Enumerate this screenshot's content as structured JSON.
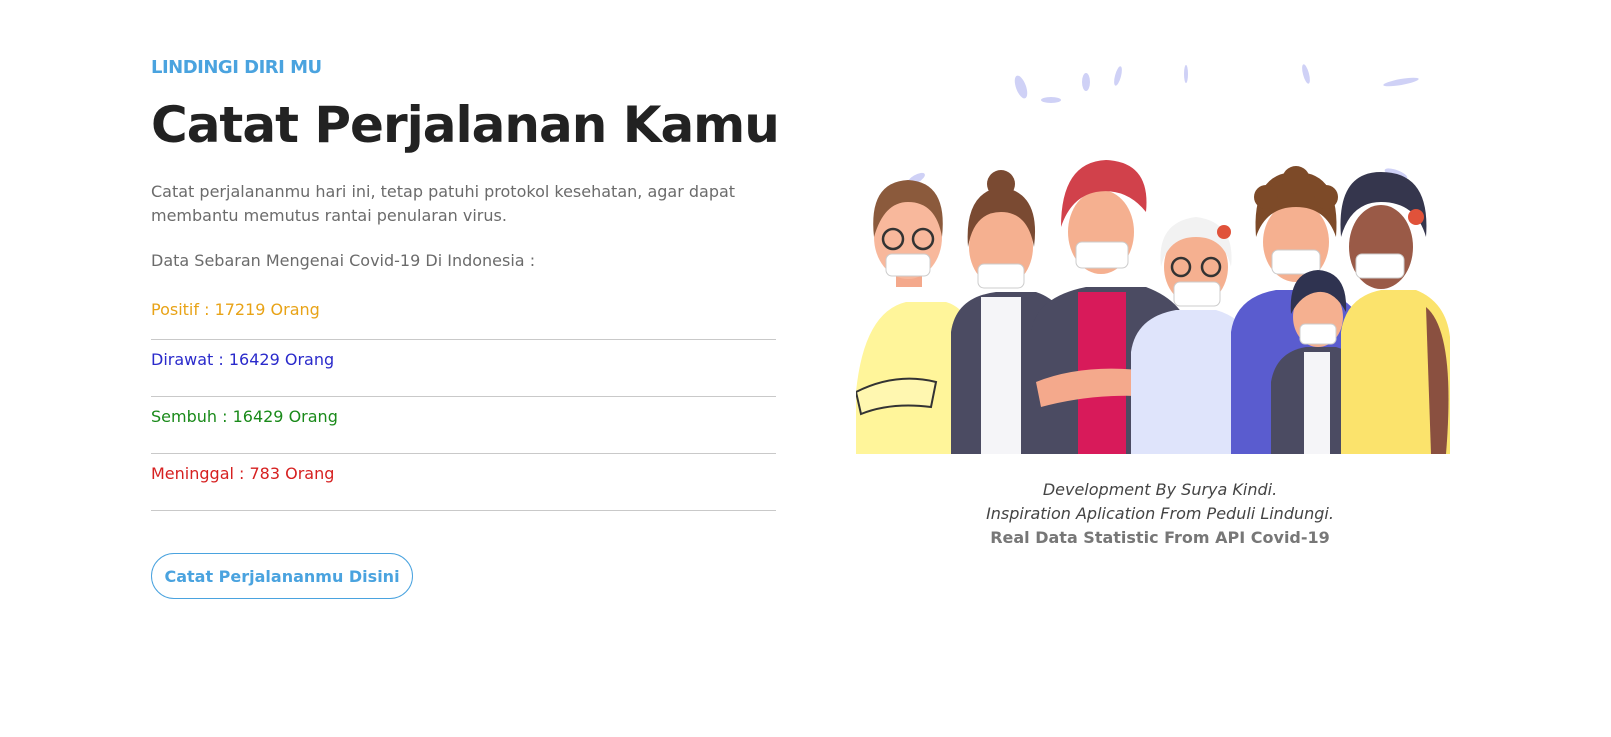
{
  "hero": {
    "eyebrow": "LINDINGI DIRI MU",
    "title": "Catat Perjalanan Kamu",
    "description": "Catat perjalananmu hari ini, tetap patuhi protokol kesehatan, agar dapat membantu memutus rantai penularan virus.",
    "stats_heading": "Data Sebaran Mengenai Covid-19 Di Indonesia :",
    "stats": [
      {
        "label": "Positif : 17219 Orang",
        "color": "#e8a317"
      },
      {
        "label": "Dirawat : 16429 Orang",
        "color": "#2a2acb"
      },
      {
        "label": "Sembuh : 16429 Orang",
        "color": "#1a8a1a"
      },
      {
        "label": "Meninggal : 783 Orang",
        "color": "#d62020"
      }
    ],
    "cta_label": "Catat Perjalananmu Disini"
  },
  "credits": {
    "line1": "Development By Surya Kindi.",
    "line2": "Inspiration Aplication From Peduli Lindungi.",
    "line3": "Real Data Statistic From API Covid-19"
  },
  "colors": {
    "accent": "#4aa3df",
    "title": "#222222",
    "body_text": "#6b6b6b"
  },
  "illustration": {
    "icon": "people-wearing-masks-illustration"
  }
}
